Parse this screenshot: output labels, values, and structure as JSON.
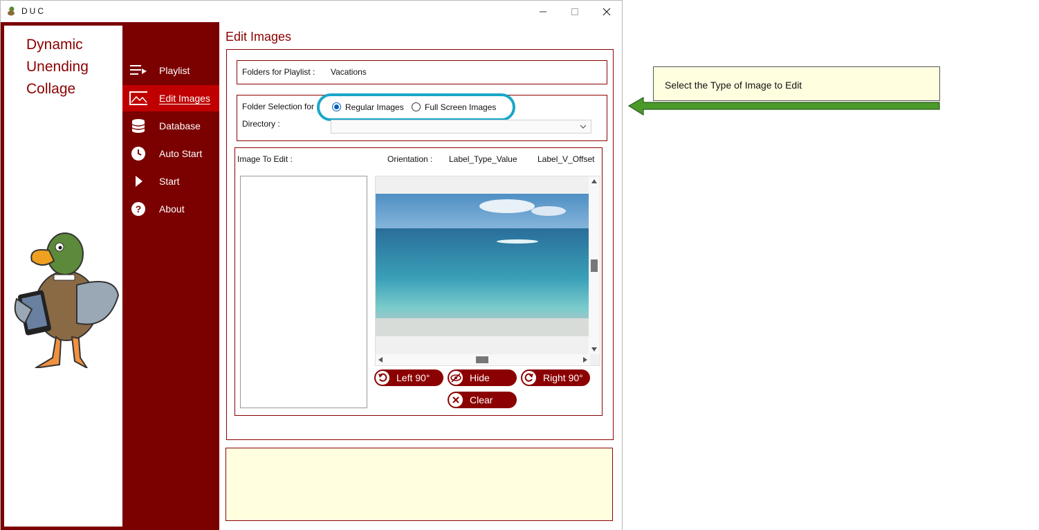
{
  "window": {
    "title": "DUC"
  },
  "logo": {
    "line1": "Dynamic",
    "line2": "Unending",
    "line3": "Collage"
  },
  "nav": {
    "items": [
      {
        "label": "Playlist",
        "icon": "playlist-icon"
      },
      {
        "label": "Edit Images",
        "icon": "image-icon",
        "active": true
      },
      {
        "label": "Database",
        "icon": "database-icon"
      },
      {
        "label": "Auto Start",
        "icon": "clock-icon"
      },
      {
        "label": "Start",
        "icon": "play-icon"
      },
      {
        "label": "About",
        "icon": "help-icon"
      }
    ]
  },
  "main": {
    "title": "Edit Images",
    "folders_label": "Folders for Playlist :",
    "folders_value": "Vacations",
    "folder_selection_label": "Folder Selection for",
    "radio_regular": "Regular Images",
    "radio_regular_selected": true,
    "radio_fullscreen": "Full Screen Images",
    "directory_label": "Directory :",
    "directory_value": "",
    "image_to_edit_label": "Image To Edit :",
    "orientation_label": "Orientation :",
    "label_type_value": "Label_Type_Value",
    "label_v_offset": "Label_V_Offset",
    "buttons": {
      "left": "Left 90°",
      "hide": "Hide",
      "right": "Right 90°",
      "clear": "Clear"
    }
  },
  "callout": {
    "text": "Select the Type of Image to Edit"
  },
  "colors": {
    "brand": "#7b0000",
    "active": "#c00000",
    "highlight": "#1aa6c8",
    "note": "#ffffe0",
    "arrow": "#4a9a2a"
  }
}
